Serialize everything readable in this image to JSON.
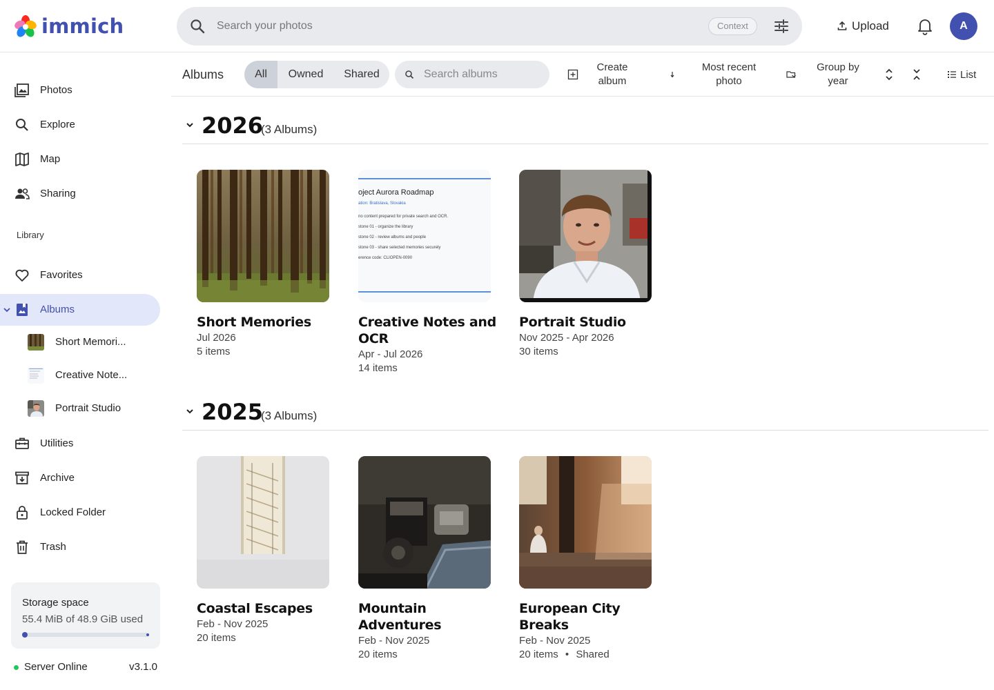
{
  "brand": {
    "name": "immich"
  },
  "header": {
    "search_placeholder": "Search your photos",
    "context_label": "Context",
    "upload_label": "Upload",
    "avatar_initial": "A"
  },
  "sidebar": {
    "items": [
      {
        "label": "Photos",
        "icon": "photos-icon"
      },
      {
        "label": "Explore",
        "icon": "search-icon"
      },
      {
        "label": "Map",
        "icon": "map-icon"
      },
      {
        "label": "Sharing",
        "icon": "people-icon"
      }
    ],
    "library_heading": "Library",
    "library_items": [
      {
        "label": "Favorites",
        "icon": "heart-icon"
      },
      {
        "label": "Albums",
        "icon": "albums-icon",
        "active": true
      }
    ],
    "album_subitems": [
      {
        "label": "Short Memori..."
      },
      {
        "label": "Creative Note..."
      },
      {
        "label": "Portrait Studio"
      }
    ],
    "more_items": [
      {
        "label": "Utilities",
        "icon": "toolbox-icon"
      },
      {
        "label": "Archive",
        "icon": "archive-icon"
      },
      {
        "label": "Locked Folder",
        "icon": "lock-icon"
      },
      {
        "label": "Trash",
        "icon": "trash-icon"
      }
    ],
    "storage": {
      "title": "Storage space",
      "used_text": "55.4 MiB of 48.9 GiB used",
      "used_fraction": 0.0011
    },
    "server": {
      "status": "Server Online",
      "version": "v3.1.0"
    }
  },
  "toolbar": {
    "title": "Albums",
    "filters": [
      "All",
      "Owned",
      "Shared"
    ],
    "active_filter": "All",
    "search_placeholder": "Search albums",
    "create_label_1": "Create",
    "create_label_2": "album",
    "sort_label_1": "Most recent",
    "sort_label_2": "photo",
    "group_label_1": "Group by",
    "group_label_2": "year",
    "view_label": "List"
  },
  "groups": [
    {
      "year": "2026",
      "count": "(3 Albums)",
      "albums": [
        {
          "title": "Short Memories",
          "dates": "Jul 2026",
          "items": "5 items",
          "cover": "forest"
        },
        {
          "title": "Creative Notes and OCR",
          "dates": "Apr - Jul 2026",
          "items": "14 items",
          "cover": "document"
        },
        {
          "title": "Portrait Studio",
          "dates": "Nov 2025 - Apr 2026",
          "items": "30 items",
          "cover": "portrait"
        }
      ]
    },
    {
      "year": "2025",
      "count": "(3 Albums)",
      "albums": [
        {
          "title": "Coastal Escapes",
          "dates": "Feb - Nov 2025",
          "items": "20 items",
          "cover": "stairs"
        },
        {
          "title": "Mountain Adventures",
          "dates": "Feb - Nov 2025",
          "items": "20 items",
          "cover": "machine"
        },
        {
          "title": "European City Breaks",
          "dates": "Feb - Nov 2025",
          "items": "20 items",
          "shared": "Shared",
          "cover": "warehouse"
        }
      ]
    }
  ],
  "doc_cover": {
    "title": "oject Aurora Roadmap",
    "subtitle": "ation: Bratislava, Slovakia",
    "lines": [
      "no content prepared for private search and OCR.",
      "stone 01 - organize the library",
      "stone 02 - review albums and people",
      "stone 03 - share selected memories securely",
      "erence code: CLIOPEN-0090"
    ]
  },
  "colors": {
    "accent": "#4250af",
    "active_bg": "#e3e7fa",
    "online": "#22c55e"
  }
}
